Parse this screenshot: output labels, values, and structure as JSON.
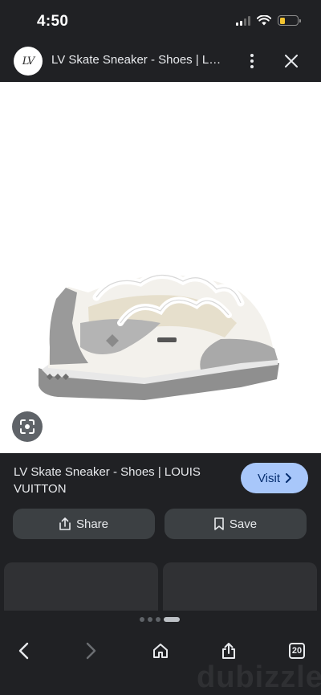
{
  "status_bar": {
    "time": "4:50",
    "icons": [
      "signal-icon",
      "wifi-icon",
      "battery-icon"
    ],
    "battery_color": "#f4c430"
  },
  "header": {
    "logo_text": "LV",
    "title": "LV Skate Sneaker - Shoes | LOUIS VUITTON",
    "icons": [
      "more-vert-icon",
      "close-icon"
    ]
  },
  "image": {
    "lens_icon": "lens-search-icon"
  },
  "result": {
    "title": "LV Skate Sneaker - Shoes | LOUIS VUITTON",
    "visit_label": "Visit",
    "share_label": "Share",
    "save_label": "Save"
  },
  "bottom_nav": {
    "tabs_count": "20",
    "icons": [
      "back-icon",
      "forward-icon",
      "home-icon",
      "share-icon",
      "tabs-icon"
    ]
  },
  "watermark": "dubizzle",
  "colors": {
    "background": "#202124",
    "visit_button": "#a8c7fa",
    "action_button": "#3c4043"
  }
}
